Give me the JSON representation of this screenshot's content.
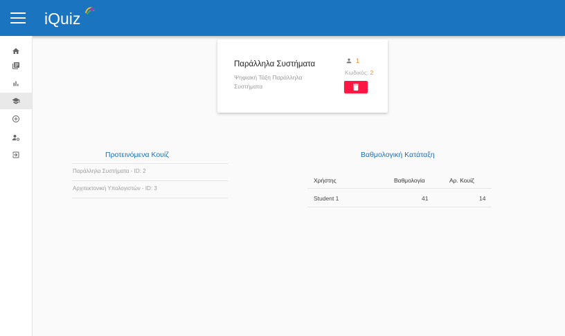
{
  "app": {
    "title": "iQuiz"
  },
  "sidebar": {
    "items": [
      {
        "icon": "home-icon"
      },
      {
        "icon": "library-books-icon"
      },
      {
        "icon": "bar-chart-icon"
      },
      {
        "icon": "graduation-cap-icon",
        "active": true
      },
      {
        "icon": "add-circle-icon"
      },
      {
        "icon": "manage-accounts-icon"
      },
      {
        "icon": "logout-icon"
      }
    ]
  },
  "course_card": {
    "title": "Παράλληλα Συστήματα",
    "subtitle": "Ψηφιακή Τάξη Παράλληλα Συστήματα",
    "users_count": "1",
    "code_label": "Κωδικός:",
    "code_value": "2",
    "delete_icon": "trash-icon"
  },
  "suggested_quizzes": {
    "title": "Προτεινόμενα Κουίζ",
    "items": [
      {
        "label": "Παράλληλα Συστήματα - ID: 2"
      },
      {
        "label": "Αρχιτεκτονική Υπολογιστών - ID: 3"
      }
    ]
  },
  "leaderboard": {
    "title": "Βαθμολογική Κατάταξη",
    "columns": [
      "Χρήστης",
      "Βαθμολογία",
      "Αρ. Κουίζ"
    ],
    "rows": [
      {
        "user": "Student 1",
        "score": "41",
        "quizzes": "14"
      }
    ]
  },
  "colors": {
    "appbar": "#1a74c0",
    "accent": "#1f6db8",
    "delete": "#ff1744",
    "highlight": "#ef8c2a"
  }
}
